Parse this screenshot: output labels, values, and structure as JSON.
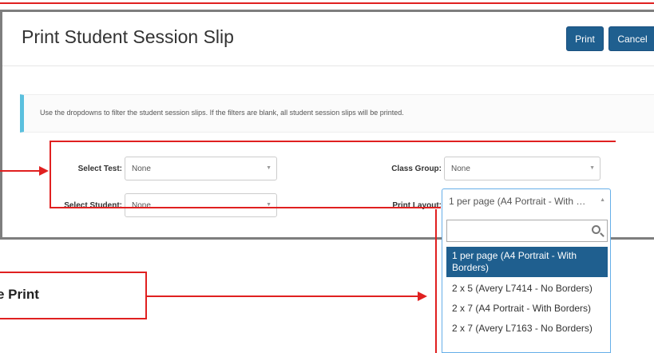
{
  "dialog": {
    "title": "Print Student Session Slip",
    "print_label": "Print",
    "cancel_label": "Cancel",
    "info_text": "Use the dropdowns to filter the student session slips. If the filters are blank, all student session slips will be printed."
  },
  "filters": {
    "select_test": {
      "label": "Select Test:",
      "value": "None"
    },
    "select_student": {
      "label": "Select Student:",
      "value": "None"
    },
    "class_group": {
      "label": "Class Group:",
      "value": "None"
    },
    "print_layout": {
      "label": "Print Layout:",
      "value": "1 per page (A4 Portrait - With …"
    }
  },
  "dropdown": {
    "options": [
      "1 per page (A4 Portrait - With Borders)",
      "2 x 5 (Avery L7414 - No Borders)",
      "2 x 7 (A4 Portrait - With Borders)",
      "2 x 7 (Avery L7163 - No Borders)"
    ],
    "selected_index": 0
  },
  "annotation": {
    "callout_text": "e Print"
  },
  "colors": {
    "primary": "#1f5f8f",
    "annotation": "#e02020",
    "info_accent": "#5bc0de"
  }
}
